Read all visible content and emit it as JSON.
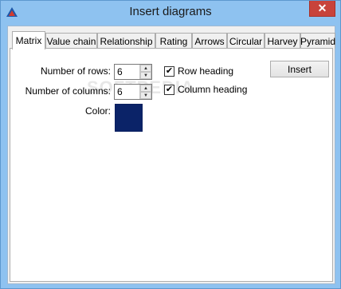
{
  "window": {
    "title": "Insert diagrams",
    "close_label": "✕"
  },
  "tabs": [
    {
      "label": "Matrix",
      "active": true
    },
    {
      "label": "Value chain"
    },
    {
      "label": "Relationship"
    },
    {
      "label": "Rating"
    },
    {
      "label": "Arrows"
    },
    {
      "label": "Circular"
    },
    {
      "label": "Harvey"
    },
    {
      "label": "Pyramid"
    }
  ],
  "matrix": {
    "rows_label": "Number of rows:",
    "rows_value": "6",
    "columns_label": "Number of columns:",
    "columns_value": "6",
    "color_label": "Color:",
    "color_value": "#0b2368",
    "row_heading_label": "Row heading",
    "row_heading_checked": true,
    "column_heading_label": "Column heading",
    "column_heading_checked": true,
    "insert_label": "Insert"
  },
  "icons": {
    "app": "triangle-logo-icon",
    "close": "close-icon",
    "spin_up": "chevron-up-icon",
    "spin_down": "chevron-down-icon",
    "check": "check-icon"
  },
  "glyphs": {
    "up": "▲",
    "down": "▼",
    "check": "✔"
  },
  "watermark": "SOFTPEDIA"
}
